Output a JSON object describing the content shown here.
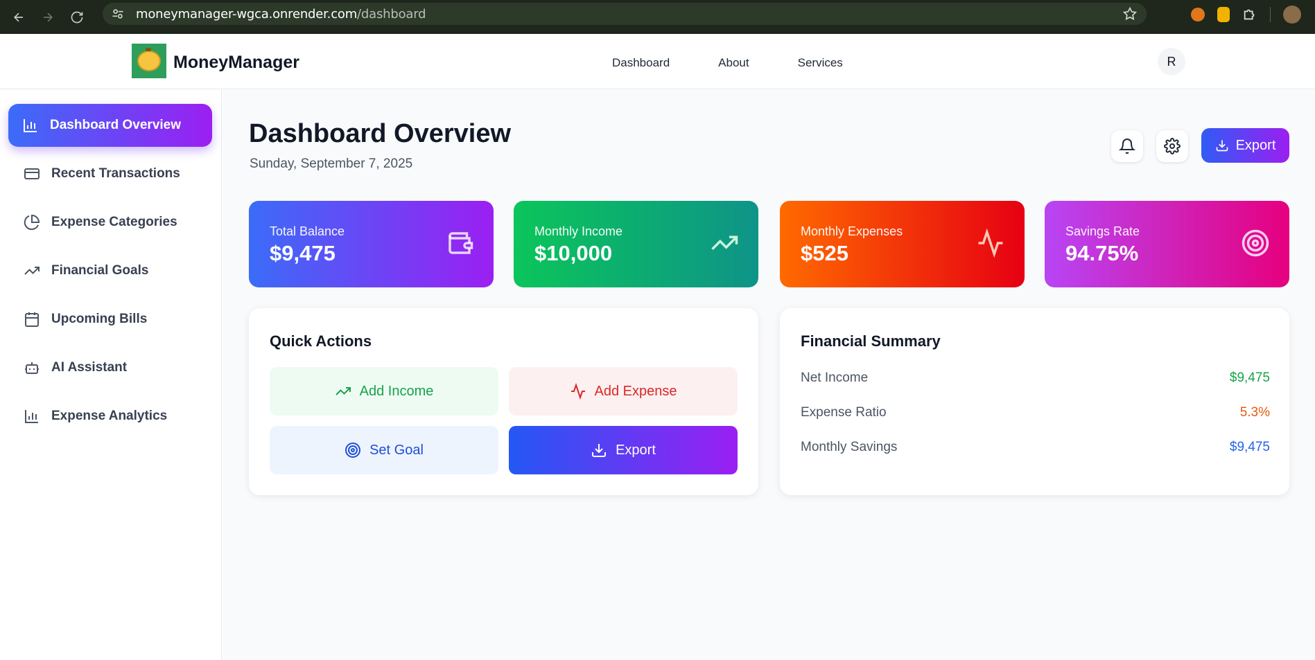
{
  "browser": {
    "url_host": "moneymanager-wgca.onrender.com",
    "url_path": "/dashboard"
  },
  "header": {
    "brand": "MoneyManager",
    "nav": [
      "Dashboard",
      "About",
      "Services"
    ],
    "avatar_initial": "R"
  },
  "sidebar": {
    "items": [
      {
        "label": "Dashboard Overview",
        "icon": "bar-chart-icon",
        "active": true
      },
      {
        "label": "Recent Transactions",
        "icon": "credit-card-icon",
        "active": false
      },
      {
        "label": "Expense Categories",
        "icon": "pie-chart-icon",
        "active": false
      },
      {
        "label": "Financial Goals",
        "icon": "trending-up-icon",
        "active": false
      },
      {
        "label": "Upcoming Bills",
        "icon": "calendar-icon",
        "active": false
      },
      {
        "label": "AI Assistant",
        "icon": "bot-icon",
        "active": false
      },
      {
        "label": "Expense Analytics",
        "icon": "bar-chart-icon",
        "active": false
      }
    ]
  },
  "main": {
    "title": "Dashboard Overview",
    "date": "Sunday, September 7, 2025",
    "export_label": "Export",
    "stats": [
      {
        "label": "Total Balance",
        "value": "$9,475",
        "icon": "wallet-icon",
        "gradient": [
          "#3b6cf8",
          "#9b1ff2"
        ]
      },
      {
        "label": "Monthly Income",
        "value": "$10,000",
        "icon": "trending-up-icon",
        "gradient": [
          "#0bc55a",
          "#0e9488"
        ]
      },
      {
        "label": "Monthly Expenses",
        "value": "$525",
        "icon": "activity-icon",
        "gradient": [
          "#ff6a00",
          "#e60012"
        ]
      },
      {
        "label": "Savings Rate",
        "value": "94.75%",
        "icon": "target-icon",
        "gradient": [
          "#b845f5",
          "#e6007e"
        ]
      }
    ],
    "quick_actions": {
      "title": "Quick Actions",
      "buttons": [
        {
          "label": "Add Income",
          "icon": "trending-up-icon"
        },
        {
          "label": "Add Expense",
          "icon": "activity-icon"
        },
        {
          "label": "Set Goal",
          "icon": "target-icon"
        },
        {
          "label": "Export",
          "icon": "download-icon"
        }
      ]
    },
    "financial_summary": {
      "title": "Financial Summary",
      "rows": [
        {
          "label": "Net Income",
          "value": "$9,475",
          "color": "#16a34a"
        },
        {
          "label": "Expense Ratio",
          "value": "5.3%",
          "color": "#ea580c"
        },
        {
          "label": "Monthly Savings",
          "value": "$9,475",
          "color": "#2563eb"
        }
      ]
    }
  }
}
